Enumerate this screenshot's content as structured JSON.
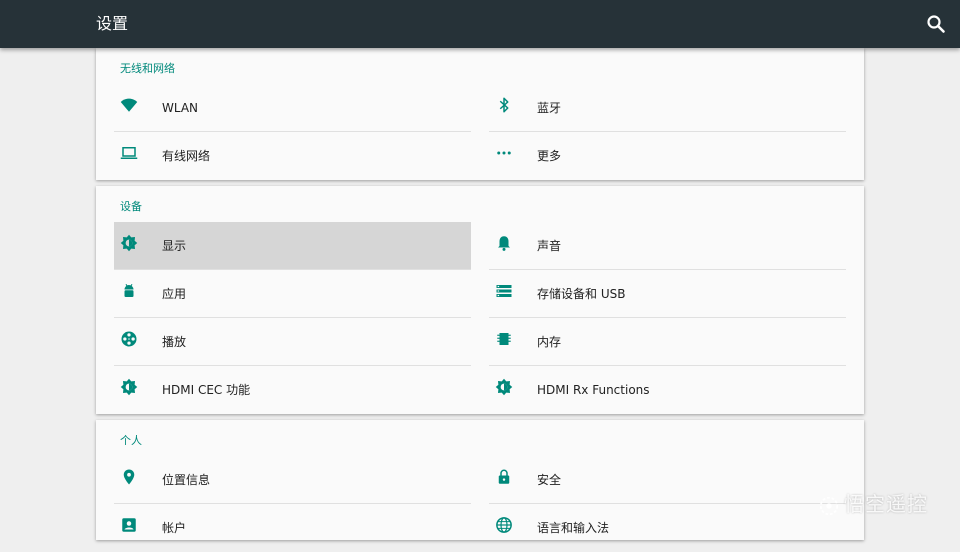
{
  "appbar": {
    "title": "设置",
    "search_icon": "search-icon"
  },
  "sections": {
    "network": {
      "header": "无线和网络",
      "items": [
        {
          "label": "WLAN",
          "icon": "wifi-icon"
        },
        {
          "label": "蓝牙",
          "icon": "bluetooth-icon"
        },
        {
          "label": "有线网络",
          "icon": "laptop-icon"
        },
        {
          "label": "更多",
          "icon": "more-dots-icon"
        }
      ]
    },
    "device": {
      "header": "设备",
      "items": [
        {
          "label": "显示",
          "icon": "brightness-icon",
          "selected": true
        },
        {
          "label": "声音",
          "icon": "bell-icon"
        },
        {
          "label": "应用",
          "icon": "android-icon"
        },
        {
          "label": "存储设备和 USB",
          "icon": "storage-icon"
        },
        {
          "label": "播放",
          "icon": "film-reel-icon"
        },
        {
          "label": "内存",
          "icon": "memory-icon"
        },
        {
          "label": "HDMI CEC 功能",
          "icon": "brightness-icon"
        },
        {
          "label": "HDMI Rx Functions",
          "icon": "brightness-icon"
        }
      ]
    },
    "personal": {
      "header": "个人",
      "items": [
        {
          "label": "位置信息",
          "icon": "location-pin-icon"
        },
        {
          "label": "安全",
          "icon": "lock-icon"
        },
        {
          "label": "帐户",
          "icon": "account-box-icon"
        },
        {
          "label": "语言和输入法",
          "icon": "globe-icon"
        }
      ]
    }
  },
  "watermark": {
    "text": "悟空遥控",
    "icon": "watermark-logo-icon"
  },
  "colors": {
    "appbar": "#263238",
    "accent": "#00897b",
    "card": "#fafafa",
    "background": "#efefef",
    "selected_row": "#d6d6d6"
  }
}
